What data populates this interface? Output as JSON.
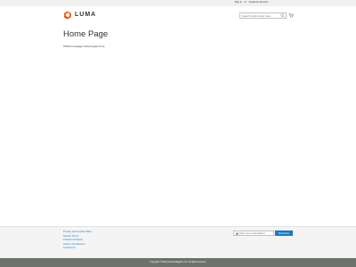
{
  "top_links": {
    "sign_in": "Sign In",
    "or": "or",
    "create_account": "Create an Account"
  },
  "header": {
    "logo_text": "LUMA",
    "search_placeholder": "Search entire store here...",
    "icons": [
      "luma-logo-icon",
      "search-icon",
      "cart-icon"
    ]
  },
  "main": {
    "title": "Home Page",
    "cms_text": "CMS homepage content goes here."
  },
  "footer": {
    "links": [
      "Privacy and Cookie Policy",
      "Search Terms",
      "Advanced Search",
      "Orders and Returns",
      "Contact Us"
    ],
    "newsletter_placeholder": "Enter your email address",
    "subscribe_label": "Subscribe"
  },
  "copyright": "Copyright © 2013-present Magento, Inc. All rights reserved.",
  "colors": {
    "accent": "#1979c3",
    "logo_orange": "#f26322",
    "copyright_bg": "#6e716e"
  }
}
